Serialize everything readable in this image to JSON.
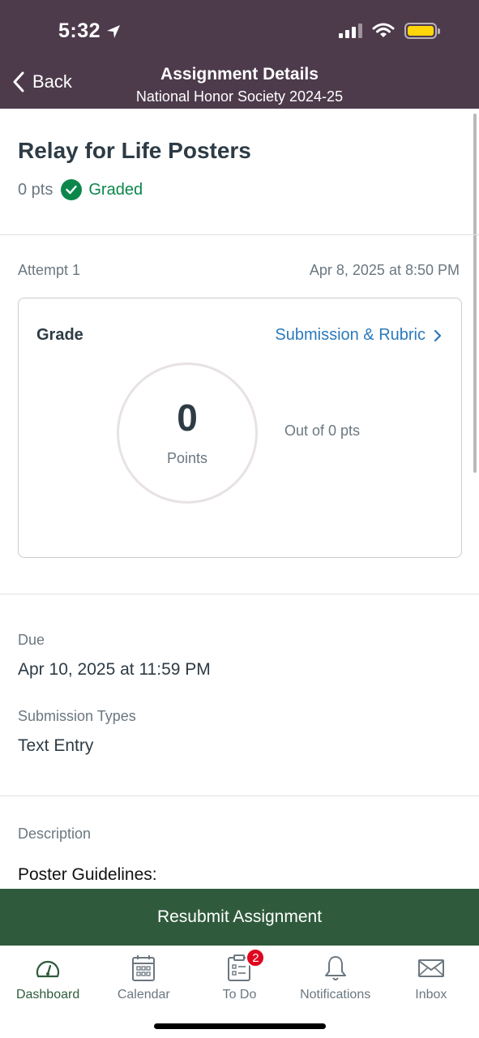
{
  "status_bar": {
    "time": "5:32"
  },
  "nav": {
    "back_label": "Back",
    "title": "Assignment Details",
    "subtitle": "National Honor Society 2024-25"
  },
  "assignment": {
    "title": "Relay for Life Posters",
    "points": "0 pts",
    "status": "Graded"
  },
  "attempt": {
    "label": "Attempt 1",
    "date": "Apr 8, 2025 at 8:50 PM"
  },
  "grade": {
    "label": "Grade",
    "rubric_link": "Submission & Rubric",
    "score": "0",
    "score_label": "Points",
    "out_of": "Out of 0 pts"
  },
  "due": {
    "label": "Due",
    "value": "Apr 10, 2025 at 11:59 PM"
  },
  "submission_types": {
    "label": "Submission Types",
    "value": "Text Entry"
  },
  "description": {
    "label": "Description",
    "first_line": "Poster Guidelines:"
  },
  "resubmit_label": "Resubmit Assignment",
  "tabs": [
    {
      "label": "Dashboard",
      "icon": "dashboard-icon",
      "active": true
    },
    {
      "label": "Calendar",
      "icon": "calendar-icon"
    },
    {
      "label": "To Do",
      "icon": "todo-icon",
      "badge": "2"
    },
    {
      "label": "Notifications",
      "icon": "bell-icon"
    },
    {
      "label": "Inbox",
      "icon": "inbox-icon"
    }
  ],
  "colors": {
    "header": "#4d3b4c",
    "accent_green": "#2f5b3c",
    "graded_green": "#0b874b",
    "link_blue": "#2b7abc",
    "badge_red": "#e0061f",
    "battery_yellow": "#ffd60a"
  }
}
